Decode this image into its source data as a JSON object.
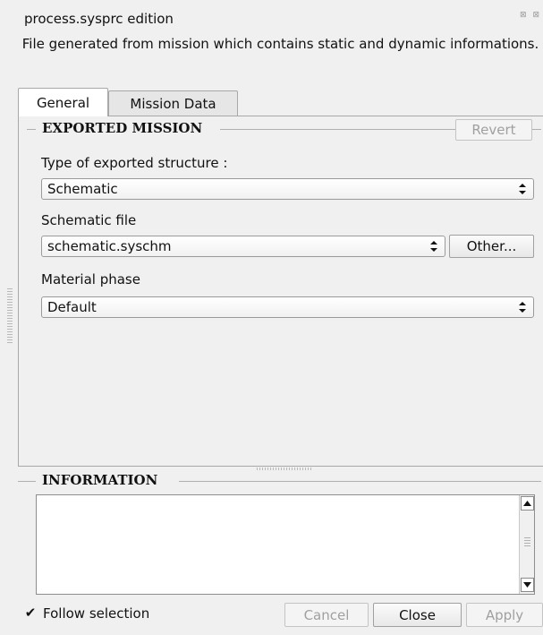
{
  "window": {
    "title": "process.sysprc edition",
    "title_icons": "⊠ ⊠",
    "description": "File generated from mission which contains static and dynamic informations."
  },
  "tabs": [
    {
      "label": "General",
      "active": true
    },
    {
      "label": "Mission Data",
      "active": false
    }
  ],
  "exported_mission": {
    "group_title": "EXPORTED MISSION",
    "revert_label": "Revert",
    "structure_type_label": "Type of exported structure :",
    "structure_type_value": "Schematic",
    "schematic_file_label": "Schematic file",
    "schematic_file_value": "schematic.syschm",
    "other_label": "Other...",
    "material_phase_label": "Material phase",
    "material_phase_value": "Default"
  },
  "information": {
    "group_title": "INFORMATION",
    "text": ""
  },
  "footer": {
    "follow_selection_label": "Follow selection",
    "follow_selection_checked": true,
    "cancel_label": "Cancel",
    "close_label": "Close",
    "apply_label": "Apply"
  },
  "icons": {
    "dropdown": "up-down-arrows-icon",
    "scroll_up": "arrow-up-icon",
    "scroll_down": "arrow-down-icon",
    "checkmark": "checkmark-icon"
  }
}
